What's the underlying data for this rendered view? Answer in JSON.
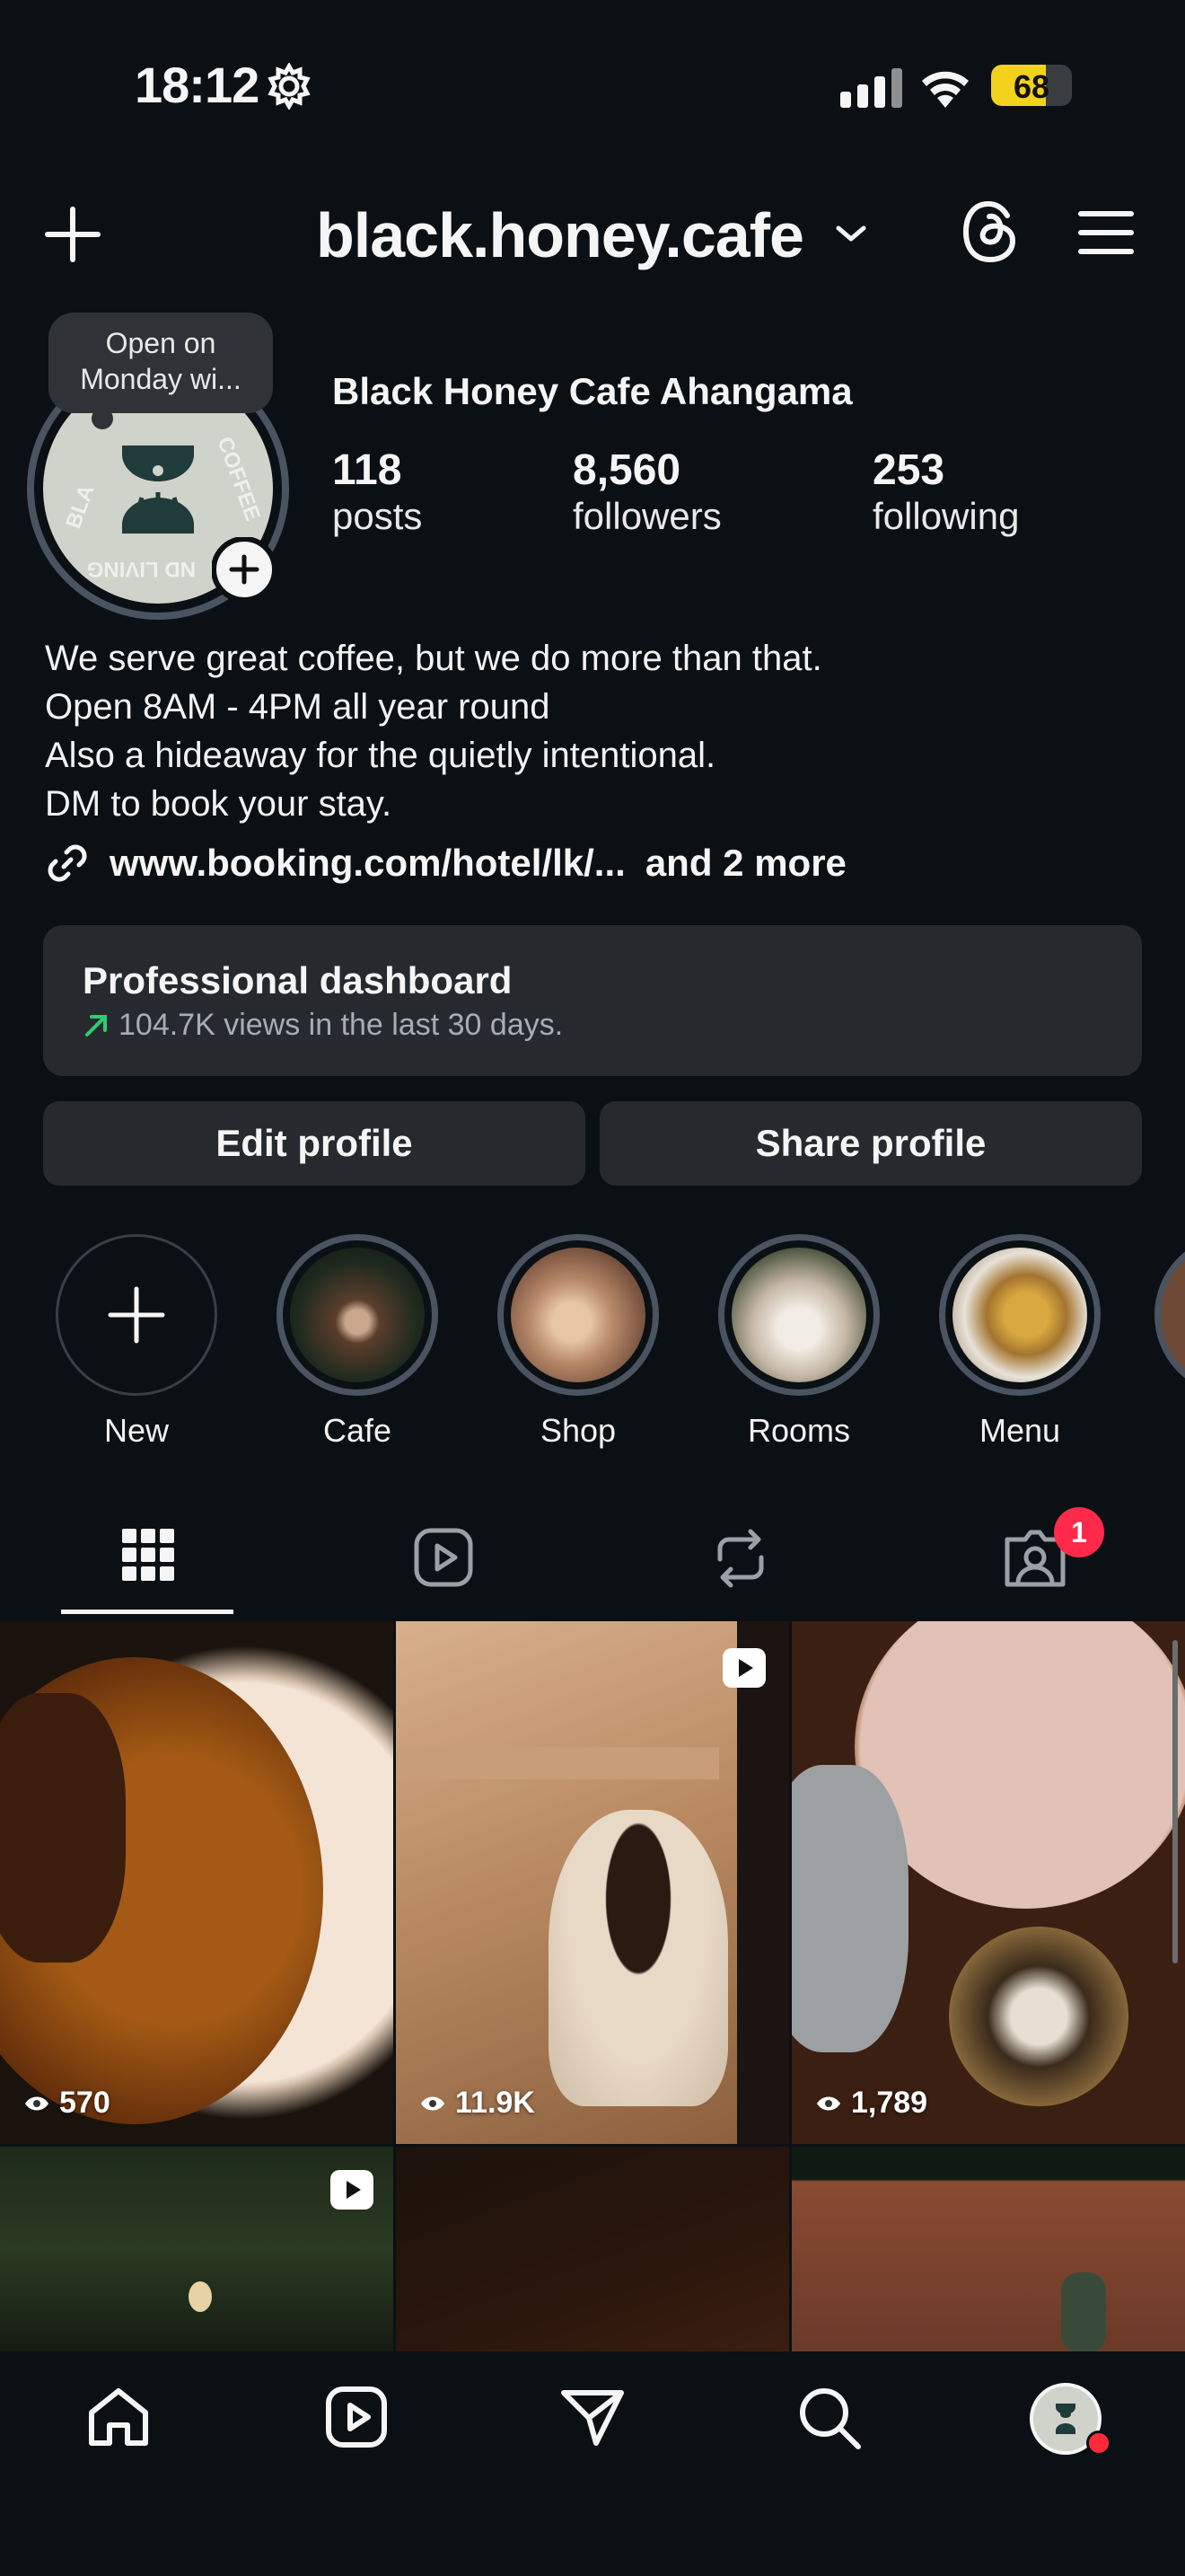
{
  "status_bar": {
    "time": "18:12",
    "battery": "68",
    "battery_level": 0.68
  },
  "header": {
    "username": "black.honey.cafe"
  },
  "tooltip": {
    "text_line1": "Open on",
    "text_line2": "Monday wi..."
  },
  "profile": {
    "name": "Black Honey Cafe Ahangama",
    "stats": [
      {
        "value": "118",
        "label": "posts"
      },
      {
        "value": "8,560",
        "label": "followers"
      },
      {
        "value": "253",
        "label": "following"
      }
    ],
    "bio": [
      "We serve great coffee, but we do more than that.",
      "Open 8AM - 4PM all year round",
      "Also a hideaway for the quietly intentional.",
      "DM to book your stay."
    ],
    "link": "www.booking.com/hotel/lk/...",
    "link_more": "and 2 more"
  },
  "dashboard": {
    "title": "Professional dashboard",
    "subtitle": "104.7K views in the last 30 days."
  },
  "buttons": {
    "edit": "Edit profile",
    "share": "Share profile"
  },
  "highlights": [
    {
      "label": "New"
    },
    {
      "label": "Cafe"
    },
    {
      "label": "Shop"
    },
    {
      "label": "Rooms"
    },
    {
      "label": "Menu"
    }
  ],
  "tabs": {
    "tagged_badge": "1"
  },
  "grid": [
    {
      "views": "570",
      "reel": false
    },
    {
      "views": "11.9K",
      "reel": true
    },
    {
      "views": "1,789",
      "reel": false
    },
    {
      "views": "",
      "reel": true
    },
    {
      "views": "",
      "reel": false
    },
    {
      "views": "",
      "reel": false
    }
  ],
  "colors": {
    "background": "#0b1014",
    "card": "#262a2f",
    "accent_red": "#ff2a4a",
    "trend_green": "#2ecc71"
  }
}
